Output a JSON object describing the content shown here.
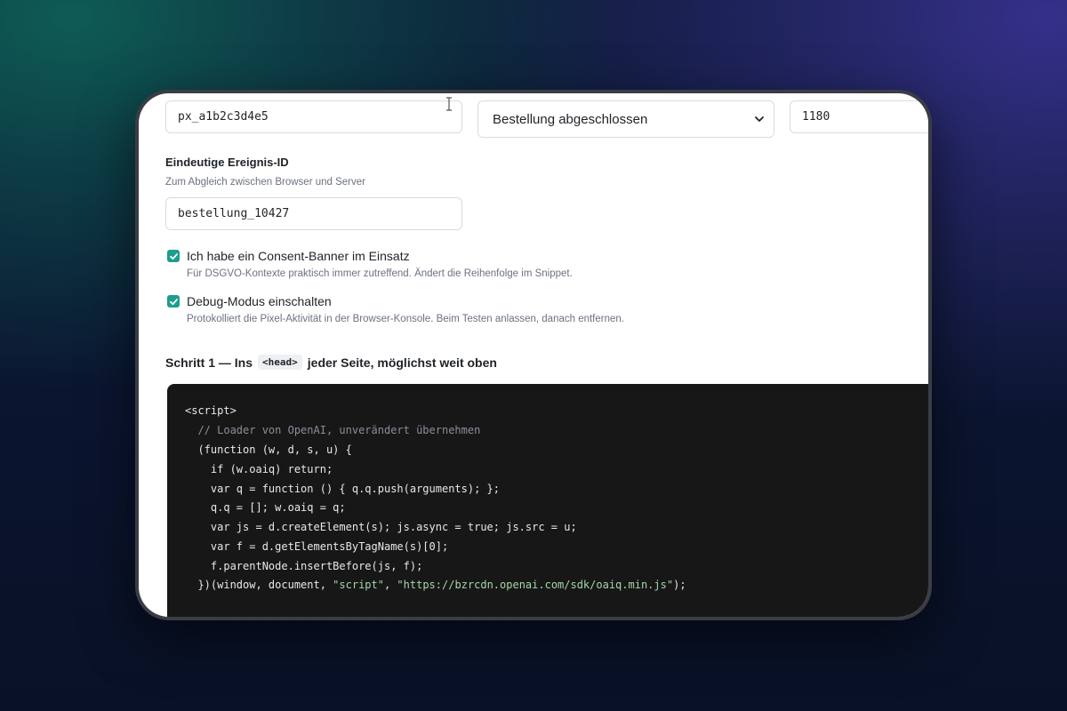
{
  "form": {
    "pixel_id_value": "px_a1b2c3d4e5",
    "event_select_value": "Bestellung abgeschlossen",
    "value_field": "1180",
    "event_id_label": "Eindeutige Ereignis-ID",
    "event_id_hint": "Zum Abgleich zwischen Browser und Server",
    "event_id_value": "bestellung_10427"
  },
  "options": [
    {
      "checked": true,
      "label": "Ich habe ein Consent-Banner im Einsatz",
      "description": "Für DSGVO-Kontexte praktisch immer zutreffend. Ändert die Reihenfolge im Snippet."
    },
    {
      "checked": true,
      "label": "Debug-Modus einschalten",
      "description": "Protokolliert die Pixel-Aktivität in der Browser-Konsole. Beim Testen anlassen, danach entfernen."
    }
  ],
  "step1": {
    "prefix": "Schritt 1 — Ins",
    "code": "<head>",
    "suffix": "jeder Seite, möglichst weit oben"
  },
  "code": {
    "line1": "<script>",
    "line2": "  // Loader von OpenAI, unverändert übernehmen",
    "line3": "  (function (w, d, s, u) {",
    "line4": "    if (w.oaiq) return;",
    "line5": "    var q = function () { q.q.push(arguments); };",
    "line6": "    q.q = []; w.oaiq = q;",
    "line7": "    var js = d.createElement(s); js.async = true; js.src = u;",
    "line8": "    var f = d.getElementsByTagName(s)[0];",
    "line9": "    f.parentNode.insertBefore(js, f);",
    "line10_start": "  })(window, document, ",
    "line10_str1": "\"script\"",
    "line10_sep": ", ",
    "line10_str2": "\"https://bzrcdn.openai.com/sdk/oaiq.min.js\"",
    "line10_end": ");"
  },
  "colors": {
    "accent": "#1c9e8c",
    "code_bg": "#171717",
    "code_string": "#a5d6a7",
    "code_comment": "#8a8f98"
  },
  "icons": {
    "checkbox": "check-icon",
    "select": "chevron-down-icon",
    "cursor": "text-cursor-icon"
  }
}
